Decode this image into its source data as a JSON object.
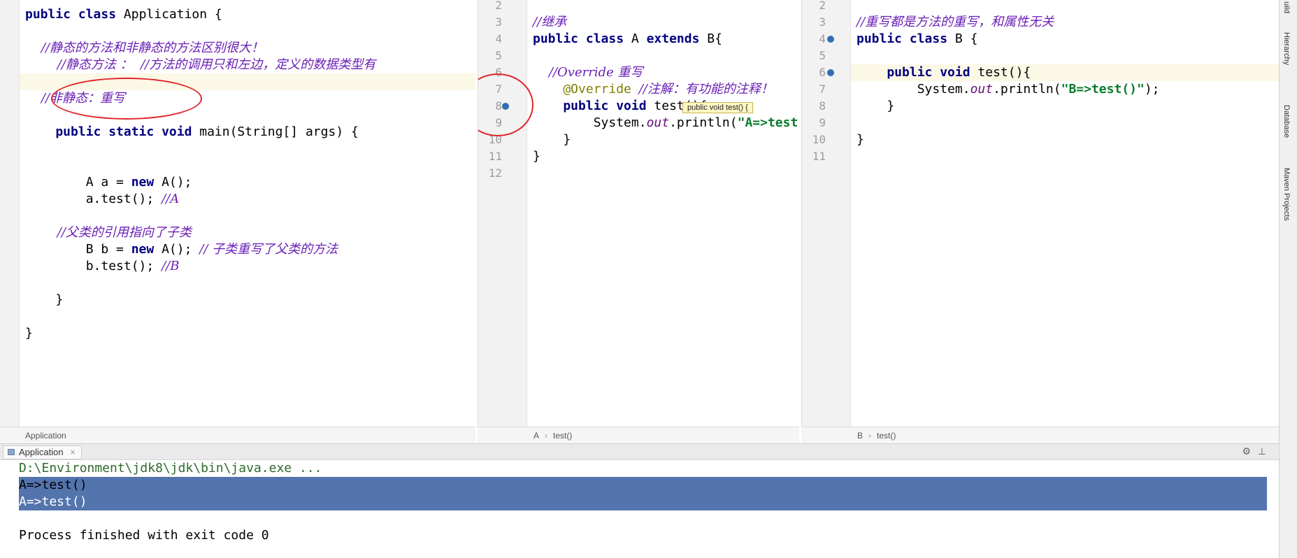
{
  "left_editor": {
    "lines": [
      {
        "parts": [
          {
            "t": "public class ",
            "c": "kw"
          },
          {
            "t": "Application {",
            "c": "plain"
          }
        ]
      },
      {
        "parts": []
      },
      {
        "parts": [
          {
            "t": "    //静态的方法和非静态的方法区别很大！",
            "c": "cm"
          }
        ]
      },
      {
        "parts": [
          {
            "t": "        //静态方法 ：  //方法的调用只和左边，定义的数据类型有",
            "c": "cm"
          }
        ]
      },
      {
        "parts": []
      },
      {
        "parts": [
          {
            "t": "    //非静态：重写",
            "c": "cm"
          }
        ]
      },
      {
        "parts": []
      },
      {
        "parts": [
          {
            "t": "    public static void ",
            "c": "kw"
          },
          {
            "t": "main(String[] args) {",
            "c": "plain"
          }
        ]
      },
      {
        "parts": []
      },
      {
        "parts": []
      },
      {
        "parts": [
          {
            "t": "        A a = ",
            "c": "plain"
          },
          {
            "t": "new ",
            "c": "kw"
          },
          {
            "t": "A();",
            "c": "plain"
          }
        ]
      },
      {
        "parts": [
          {
            "t": "        a.test(); ",
            "c": "plain"
          },
          {
            "t": "//A",
            "c": "cm"
          }
        ]
      },
      {
        "parts": []
      },
      {
        "parts": [
          {
            "t": "        //父类的引用指向了子类",
            "c": "cm"
          }
        ]
      },
      {
        "parts": [
          {
            "t": "        B b = ",
            "c": "plain"
          },
          {
            "t": "new ",
            "c": "kw"
          },
          {
            "t": "A(); ",
            "c": "plain"
          },
          {
            "t": "// 子类重写了父类的方法",
            "c": "cm"
          }
        ]
      },
      {
        "parts": [
          {
            "t": "        b.test(); ",
            "c": "plain"
          },
          {
            "t": "//B",
            "c": "cm"
          }
        ]
      },
      {
        "parts": []
      },
      {
        "parts": [
          {
            "t": "    }",
            "c": "plain"
          }
        ]
      },
      {
        "parts": []
      },
      {
        "parts": [
          {
            "t": "}",
            "c": "plain"
          }
        ]
      }
    ],
    "breadcrumb": "Application"
  },
  "mid_editor": {
    "line_numbers": [
      "2",
      "3",
      "4",
      "5",
      "6",
      "7",
      "8",
      "9",
      "10",
      "11",
      "12"
    ],
    "lines": [
      {
        "parts": []
      },
      {
        "parts": [
          {
            "t": "//继承",
            "c": "cm"
          }
        ]
      },
      {
        "parts": [
          {
            "t": "public class ",
            "c": "kw"
          },
          {
            "t": "A ",
            "c": "plain"
          },
          {
            "t": "extends ",
            "c": "kw"
          },
          {
            "t": "B{",
            "c": "plain"
          }
        ]
      },
      {
        "parts": []
      },
      {
        "parts": [
          {
            "t": "    //Override 重写",
            "c": "cm"
          }
        ]
      },
      {
        "parts": [
          {
            "t": "    @Override ",
            "c": "ann"
          },
          {
            "t": "//注解：有功能的注释！",
            "c": "cm"
          }
        ]
      },
      {
        "parts": [
          {
            "t": "    public void ",
            "c": "kw"
          },
          {
            "t": "test(){",
            "c": "plain"
          }
        ]
      },
      {
        "parts": [
          {
            "t": "        System.",
            "c": "plain"
          },
          {
            "t": "out",
            "c": "fld"
          },
          {
            "t": ".println(",
            "c": "plain"
          },
          {
            "t": "\"A=>test()\"",
            "c": "str"
          },
          {
            "t": ");",
            "c": "plain"
          }
        ]
      },
      {
        "parts": [
          {
            "t": "    }",
            "c": "plain"
          }
        ]
      },
      {
        "parts": [
          {
            "t": "}",
            "c": "plain"
          }
        ]
      },
      {
        "parts": []
      }
    ],
    "tooltip": "public void test() {",
    "breadcrumb": [
      "A",
      "test()"
    ]
  },
  "right_editor": {
    "line_numbers": [
      "2",
      "3",
      "4",
      "5",
      "6",
      "7",
      "8",
      "9",
      "10",
      "11"
    ],
    "lines": [
      {
        "parts": []
      },
      {
        "parts": [
          {
            "t": "//重写都是方法的重写，和属性无关",
            "c": "cm"
          }
        ]
      },
      {
        "parts": [
          {
            "t": "public class ",
            "c": "kw"
          },
          {
            "t": "B {",
            "c": "plain"
          }
        ]
      },
      {
        "parts": []
      },
      {
        "parts": [
          {
            "t": "    public void ",
            "c": "kw"
          },
          {
            "t": "test(){",
            "c": "plain"
          }
        ]
      },
      {
        "parts": [
          {
            "t": "        System.",
            "c": "plain"
          },
          {
            "t": "out",
            "c": "fld"
          },
          {
            "t": ".println(",
            "c": "plain"
          },
          {
            "t": "\"B=>test()\"",
            "c": "str"
          },
          {
            "t": ");",
            "c": "plain"
          }
        ]
      },
      {
        "parts": [
          {
            "t": "    }",
            "c": "plain"
          }
        ]
      },
      {
        "parts": []
      },
      {
        "parts": [
          {
            "t": "}",
            "c": "plain"
          }
        ]
      },
      {
        "parts": []
      }
    ],
    "breadcrumb": [
      "B",
      "test()"
    ]
  },
  "run_panel": {
    "tab_label": "Application",
    "console_lines": [
      {
        "text": "D:\\Environment\\jdk8\\jdk\\bin\\java.exe ...",
        "color": "#2d6b2d"
      },
      {
        "text": "A=>test()",
        "color": "#000000",
        "selected": true
      },
      {
        "text": "A=>test()",
        "color": "#ffffff",
        "selected": true
      },
      {
        "text": "",
        "color": "#000000"
      },
      {
        "text": "Process finished with exit code 0",
        "color": "#000000"
      }
    ]
  },
  "sidebar": {
    "labels": [
      "uild",
      "Hierarchy",
      "Database",
      "Maven Projects"
    ]
  }
}
